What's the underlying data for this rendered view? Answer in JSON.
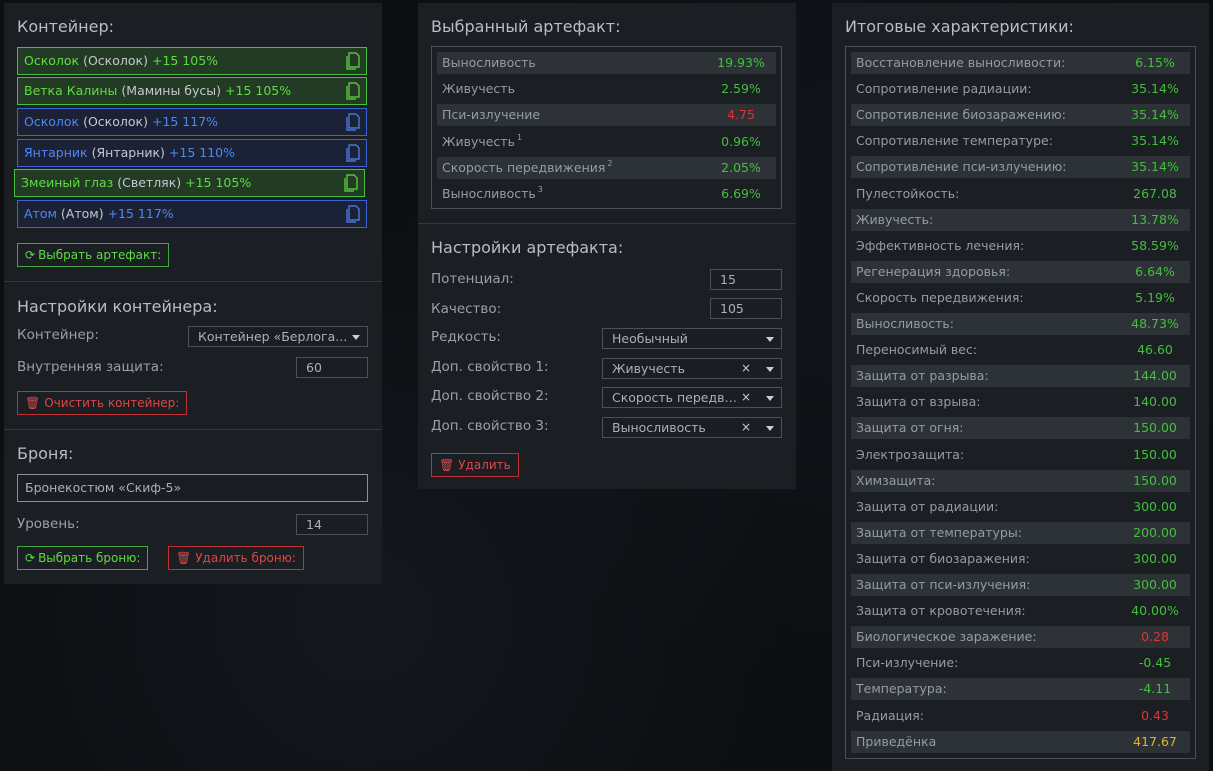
{
  "container_panel": {
    "title": "Контейнер:",
    "items": [
      {
        "name": "Осколок",
        "sub": "(Осколок)",
        "bonus": "+15 105%",
        "style": "green"
      },
      {
        "name": "Ветка Калины",
        "sub": "(Мамины бусы)",
        "bonus": "+15 105%",
        "style": "green"
      },
      {
        "name": "Осколок",
        "sub": "(Осколок)",
        "bonus": "+15 117%",
        "style": "blue"
      },
      {
        "name": "Янтарник",
        "sub": "(Янтарник)",
        "bonus": "+15 110%",
        "style": "blue"
      },
      {
        "name": "Змеиный глаз",
        "sub": "(Светляк)",
        "bonus": "+15 105%",
        "style": "green"
      },
      {
        "name": "Атом",
        "sub": "(Атом)",
        "bonus": "+15 117%",
        "style": "blue"
      }
    ],
    "select_artifact_label": "Выбрать артефакт:"
  },
  "container_settings": {
    "title": "Настройки контейнера:",
    "container_label": "Контейнер:",
    "container_value": "Контейнер «Берлога...",
    "internal_protection_label": "Внутренняя защита:",
    "internal_protection_value": "60",
    "clear_label": "Очистить контейнер:"
  },
  "armor": {
    "title": "Броня:",
    "armor_value": "Бронекостюм «Скиф-5»",
    "level_label": "Уровень:",
    "level_value": "14",
    "select_label": "Выбрать броню:",
    "delete_label": "Удалить броню:"
  },
  "selected_artifact": {
    "title": "Выбранный артефакт:",
    "rows": [
      {
        "key": "Выносливость",
        "sup": "",
        "value": "19.93%",
        "color": "green"
      },
      {
        "key": "Живучесть",
        "sup": "",
        "value": "2.59%",
        "color": "green"
      },
      {
        "key": "Пси-излучение",
        "sup": "",
        "value": "4.75",
        "color": "red"
      },
      {
        "key": "Живучесть",
        "sup": "1",
        "value": "0.96%",
        "color": "green"
      },
      {
        "key": "Скорость передвижения",
        "sup": "2",
        "value": "2.05%",
        "color": "green"
      },
      {
        "key": "Выносливость",
        "sup": "3",
        "value": "6.69%",
        "color": "green"
      }
    ]
  },
  "artifact_settings": {
    "title": "Настройки артефакта:",
    "potential_label": "Потенциал:",
    "potential_value": "15",
    "quality_label": "Качество:",
    "quality_value": "105",
    "rarity_label": "Редкость:",
    "rarity_value": "Необычный",
    "prop1_label": "Доп. свойство 1:",
    "prop1_value": "Живучесть",
    "prop2_label": "Доп. свойство 2:",
    "prop2_value": "Скорость передви...",
    "prop3_label": "Доп. свойство 3:",
    "prop3_value": "Выносливость",
    "clear_glyph": "×",
    "delete_label": "Удалить"
  },
  "totals": {
    "title": "Итоговые характеристики:",
    "rows": [
      {
        "key": "Восстановление выносливости:",
        "value": "6.15%",
        "color": "green"
      },
      {
        "key": "Сопротивление радиации:",
        "value": "35.14%",
        "color": "green"
      },
      {
        "key": "Сопротивление биозаражению:",
        "value": "35.14%",
        "color": "green"
      },
      {
        "key": "Сопротивление температуре:",
        "value": "35.14%",
        "color": "green"
      },
      {
        "key": "Сопротивление пси-излучению:",
        "value": "35.14%",
        "color": "green"
      },
      {
        "key": "Пулестойкость:",
        "value": "267.08",
        "color": "green"
      },
      {
        "key": "Живучесть:",
        "value": "13.78%",
        "color": "green"
      },
      {
        "key": "Эффективность лечения:",
        "value": "58.59%",
        "color": "green"
      },
      {
        "key": "Регенерация здоровья:",
        "value": "6.64%",
        "color": "green"
      },
      {
        "key": "Скорость передвижения:",
        "value": "5.19%",
        "color": "green"
      },
      {
        "key": "Выносливость:",
        "value": "48.73%",
        "color": "green"
      },
      {
        "key": "Переносимый вес:",
        "value": "46.60",
        "color": "green"
      },
      {
        "key": "Защита от разрыва:",
        "value": "144.00",
        "color": "green"
      },
      {
        "key": "Защита от взрыва:",
        "value": "140.00",
        "color": "green"
      },
      {
        "key": "Защита от огня:",
        "value": "150.00",
        "color": "green"
      },
      {
        "key": "Электрозащита:",
        "value": "150.00",
        "color": "green"
      },
      {
        "key": "Химзащита:",
        "value": "150.00",
        "color": "green"
      },
      {
        "key": "Защита от радиации:",
        "value": "300.00",
        "color": "green"
      },
      {
        "key": "Защита от температуры:",
        "value": "200.00",
        "color": "green"
      },
      {
        "key": "Защита от биозаражения:",
        "value": "300.00",
        "color": "green"
      },
      {
        "key": "Защита от пси-излучения:",
        "value": "300.00",
        "color": "green"
      },
      {
        "key": "Защита от кровотечения:",
        "value": "40.00%",
        "color": "green"
      },
      {
        "key": "Биологическое заражение:",
        "value": "0.28",
        "color": "red"
      },
      {
        "key": "Пси-излучение:",
        "value": "-0.45",
        "color": "green"
      },
      {
        "key": "Температура:",
        "value": "-4.11",
        "color": "green"
      },
      {
        "key": "Радиация:",
        "value": "0.43",
        "color": "red"
      },
      {
        "key": "Приведёнка",
        "value": "417.67",
        "color": "yellow"
      }
    ]
  },
  "colors": {
    "green": "#42c03c",
    "red": "#de3434",
    "yellow": "#e6b22a",
    "blue": "#4e86f5"
  }
}
